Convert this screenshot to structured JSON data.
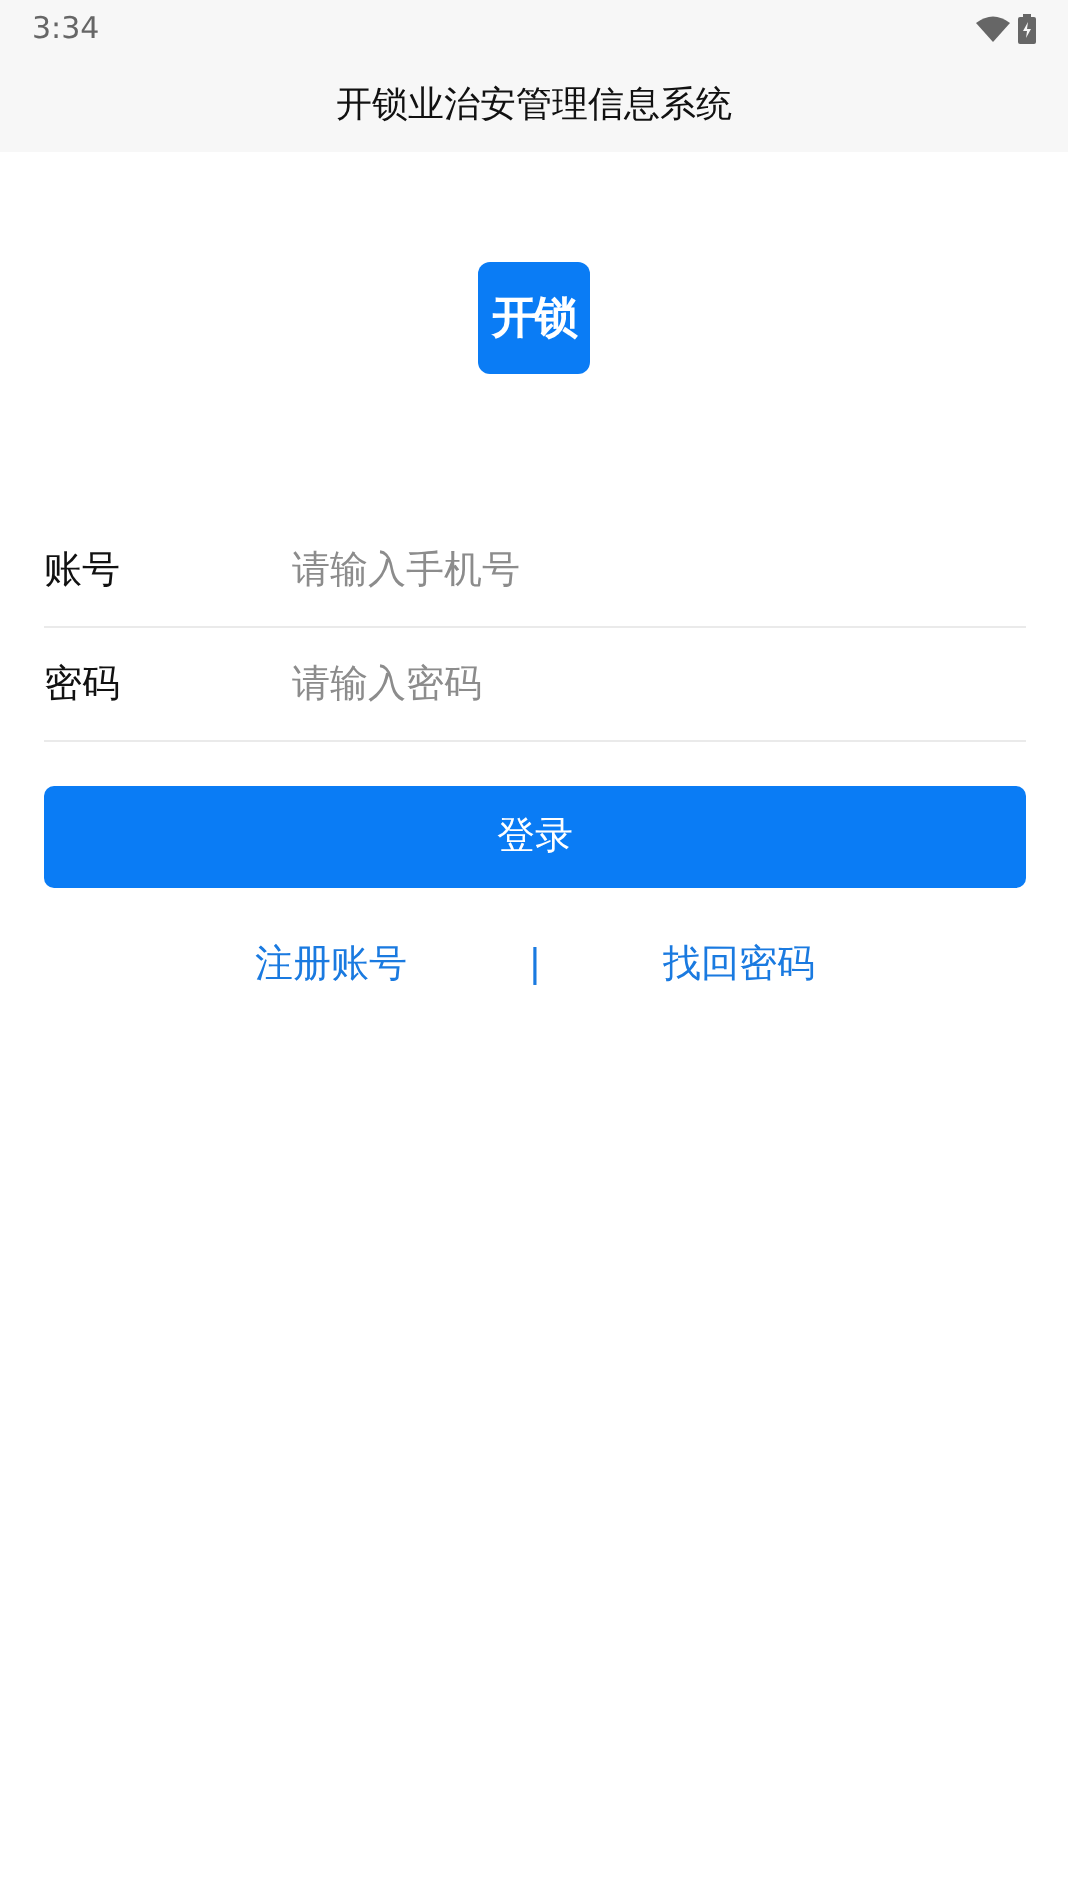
{
  "status_bar": {
    "time": "3:34"
  },
  "header": {
    "title": "开锁业治安管理信息系统"
  },
  "logo": {
    "text": "开锁"
  },
  "fields": [
    {
      "label": "账号",
      "placeholder": "请输入手机号"
    },
    {
      "label": "密码",
      "placeholder": "请输入密码"
    }
  ],
  "login_button": "登录",
  "links": [
    {
      "label": "注册账号"
    },
    {
      "label": "找回密码"
    }
  ],
  "link_separator": "|"
}
